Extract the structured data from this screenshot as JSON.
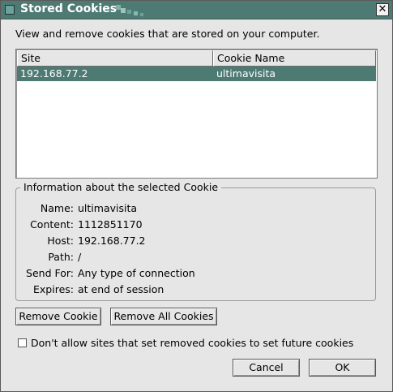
{
  "window": {
    "title": "Stored Cookies",
    "close_glyph": "✕"
  },
  "intro_text": "View and remove cookies that are stored on your computer.",
  "cookie_list": {
    "columns": [
      "Site",
      "Cookie Name"
    ],
    "rows": [
      {
        "site": "192.168.77.2",
        "name": "ultimavisita",
        "selected": true
      }
    ]
  },
  "info": {
    "legend": "Information about the selected Cookie",
    "fields": [
      {
        "label": "Name:",
        "value": "ultimavisita"
      },
      {
        "label": "Content:",
        "value": "1112851170"
      },
      {
        "label": "Host:",
        "value": "192.168.77.2"
      },
      {
        "label": "Path:",
        "value": "/"
      },
      {
        "label": "Send For:",
        "value": "Any type of connection"
      },
      {
        "label": "Expires:",
        "value": "at end of session"
      }
    ]
  },
  "buttons": {
    "remove_cookie": "Remove Cookie",
    "remove_all": "Remove All Cookies",
    "cancel": "Cancel",
    "ok": "OK"
  },
  "checkbox": {
    "label": "Don't allow sites that set removed cookies to set future cookies",
    "checked": false
  },
  "colors": {
    "accent": "#4e7a74",
    "background": "#e6e6e6"
  }
}
